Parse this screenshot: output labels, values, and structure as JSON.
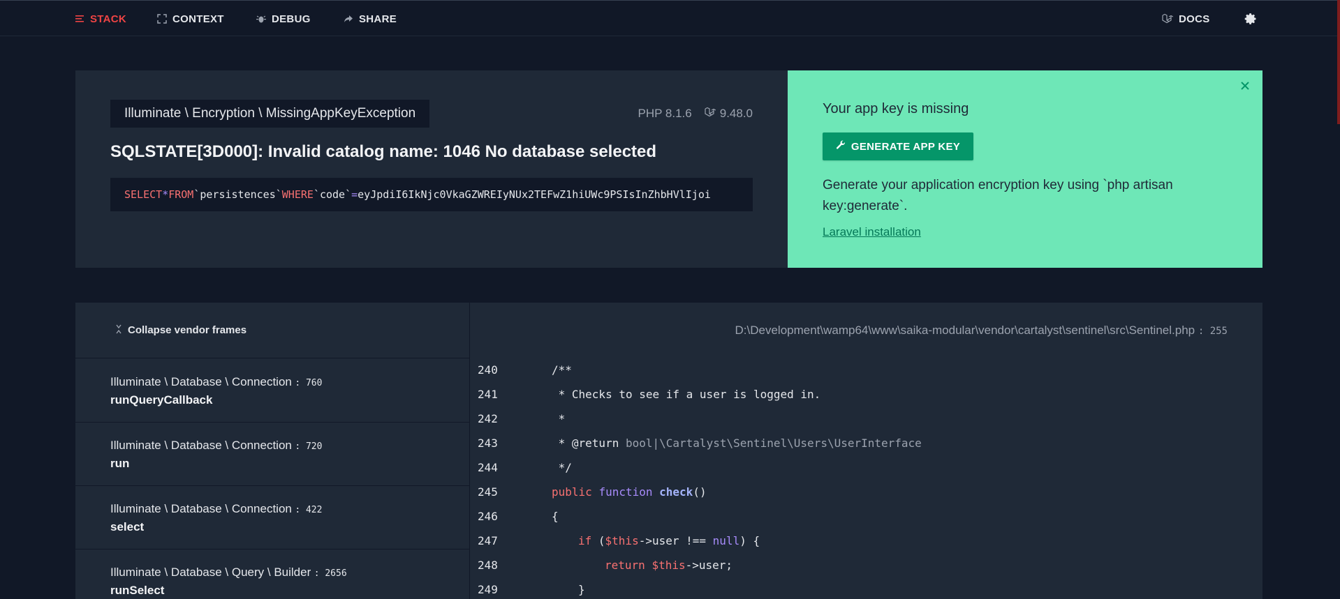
{
  "nav": {
    "stack": "STACK",
    "context": "CONTEXT",
    "debug": "DEBUG",
    "share": "SHARE",
    "docs": "DOCS"
  },
  "exception": {
    "class": "Illuminate \\ Encryption \\ MissingAppKeyException",
    "php_version": "PHP 8.1.6",
    "laravel_version": "9.48.0",
    "message": "SQLSTATE[3D000]: Invalid catalog name: 1046 No database selected",
    "sql": {
      "select": "SELECT",
      "star": "*",
      "from": "FROM",
      "table": "`persistences`",
      "where": "WHERE",
      "column": "`code`",
      "eq": "=",
      "value": "eyJpdiI6IkNjc0VkaGZWREIyNUx2TEFwZ1hiUWc9PSIsInZhbHVlIjoi"
    }
  },
  "solution": {
    "title": "Your app key is missing",
    "button": "GENERATE APP KEY",
    "description": "Generate your application encryption key using `php artisan key:generate`.",
    "link": "Laravel installation"
  },
  "stack": {
    "collapse_label": "Collapse vendor frames",
    "frames": [
      {
        "class": "Illuminate \\ Database \\ Connection",
        "line": ": 760",
        "method": "runQueryCallback"
      },
      {
        "class": "Illuminate \\ Database \\ Connection",
        "line": ": 720",
        "method": "run"
      },
      {
        "class": "Illuminate \\ Database \\ Connection",
        "line": ": 422",
        "method": "select"
      },
      {
        "class": "Illuminate \\ Database \\ Query \\ Builder",
        "line": ": 2656",
        "method": "runSelect"
      }
    ],
    "file": {
      "path": "D:\\Development\\wamp64\\www\\saika-modular\\vendor\\cartalyst\\sentinel\\src\\Sentinel",
      "ext": ".php",
      "line": ": 255"
    },
    "code": [
      {
        "num": "240"
      },
      {
        "num": "241"
      },
      {
        "num": "242"
      },
      {
        "num": "243"
      },
      {
        "num": "244"
      },
      {
        "num": "245"
      },
      {
        "num": "246"
      },
      {
        "num": "247"
      },
      {
        "num": "248"
      },
      {
        "num": "249"
      }
    ],
    "code_text": {
      "l240": "/**",
      "l241": " * Checks to see if a user is logged in.",
      "l242": " *",
      "l243_a": " * @return ",
      "l243_b": "bool|\\Cartalyst\\Sentinel\\Users\\UserInterface",
      "l244": " */",
      "l245_public": "public",
      "l245_function": "function",
      "l245_name": "check",
      "l245_paren": "()",
      "l246": "{",
      "l247_if": "if",
      "l247_open": " (",
      "l247_this": "$this",
      "l247_rest": "->user !== ",
      "l247_null": "null",
      "l247_close": ") {",
      "l248_return": "return",
      "l248_sp": " ",
      "l248_this": "$this",
      "l248_rest": "->user;",
      "l249": "}"
    }
  },
  "colors": {
    "background": "#111827",
    "panel": "#1f2937",
    "accent_red": "#ef4444",
    "solution_green": "#6ee7b7",
    "button_green": "#059669"
  },
  "icons": [
    "stack-icon",
    "context-icon",
    "debug-icon",
    "share-icon",
    "laravel-icon",
    "gear-icon",
    "close-icon",
    "wrench-icon",
    "collapse-icon"
  ]
}
